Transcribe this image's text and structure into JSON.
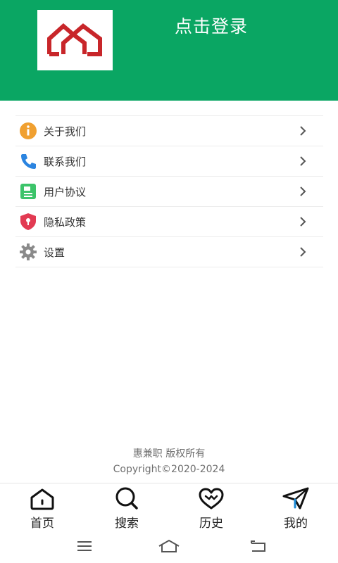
{
  "header": {
    "login_text": "点击登录",
    "bg_color": "#0aa663",
    "logo_icon": "house-logo-icon",
    "logo_color": "#c8262a"
  },
  "menu": {
    "items": [
      {
        "label": "关于我们",
        "icon": "info-icon",
        "color": "#f0a030"
      },
      {
        "label": "联系我们",
        "icon": "phone-icon",
        "color": "#2b84e0"
      },
      {
        "label": "用户协议",
        "icon": "document-icon",
        "color": "#3cc46a"
      },
      {
        "label": "隐私政策",
        "icon": "shield-lock-icon",
        "color": "#e23a52"
      },
      {
        "label": "设置",
        "icon": "gear-icon",
        "color": "#8a8a8a"
      }
    ]
  },
  "footer": {
    "line1": "惠兼职 版权所有",
    "line2": "Copyright©2020-2024"
  },
  "tabbar": {
    "tabs": [
      {
        "label": "首页",
        "icon": "home-icon"
      },
      {
        "label": "搜索",
        "icon": "search-icon"
      },
      {
        "label": "历史",
        "icon": "heart-icon"
      },
      {
        "label": "我的",
        "icon": "paper-plane-icon"
      }
    ]
  },
  "system_nav": {
    "buttons": [
      "menu-icon",
      "home-outline-icon",
      "back-icon"
    ]
  }
}
